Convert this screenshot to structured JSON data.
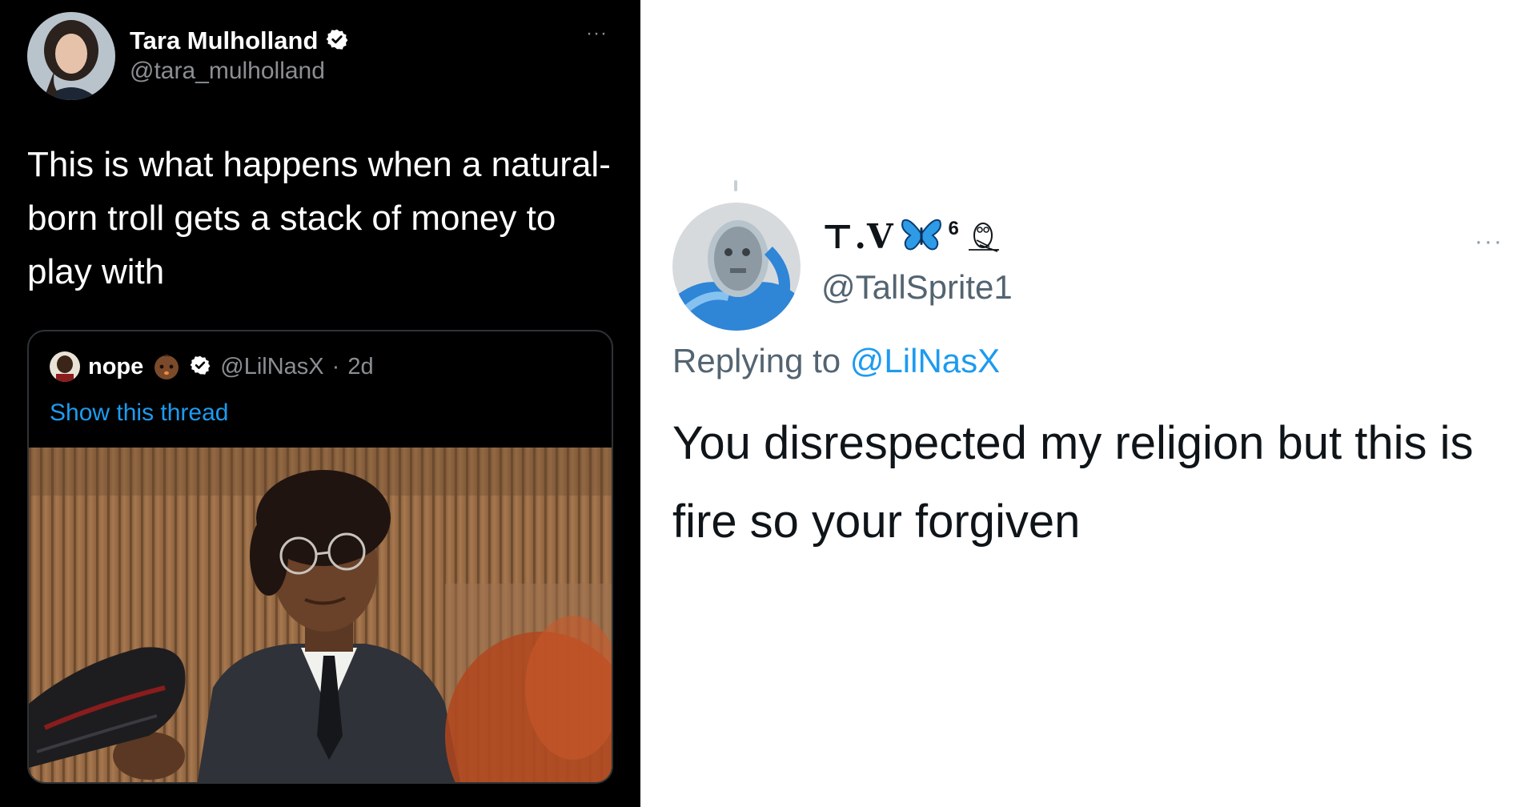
{
  "left_tweet": {
    "author_name": "Tara Mulholland",
    "author_handle": "@tara_mulholland",
    "more_label": "···",
    "text": "This is what happens when a natural-born troll gets a stack of money to play with",
    "quoted_tweet": {
      "author_name": "nope",
      "author_handle": "@LilNasX",
      "separator": "·",
      "age": "2d",
      "show_thread_label": "Show this thread"
    }
  },
  "right_tweet": {
    "author_name_text": "⊤.V",
    "author_name_superscript": "6",
    "author_handle": "@TallSprite1",
    "more_label": "···",
    "replying_prefix": "Replying to ",
    "replying_to": "@LilNasX",
    "text": "You disrespected my religion but this is fire so your forgiven"
  },
  "colors": {
    "dark_background": "#000000",
    "light_background": "#ffffff",
    "link_blue": "#1d9bf0",
    "verified_blue": "#1d9bf0",
    "muted_gray": "#8b8f94",
    "butterfly_blue": "#2e9be6"
  },
  "icons": {
    "left_verified": "verified-badge-icon",
    "quote_verified": "verified-badge-icon",
    "quote_emoji": "baby-emoji-icon",
    "right_name_emoji_1": "butterfly-emoji-icon",
    "right_name_emoji_2": "owl-icon",
    "more": "more-options-icon"
  }
}
